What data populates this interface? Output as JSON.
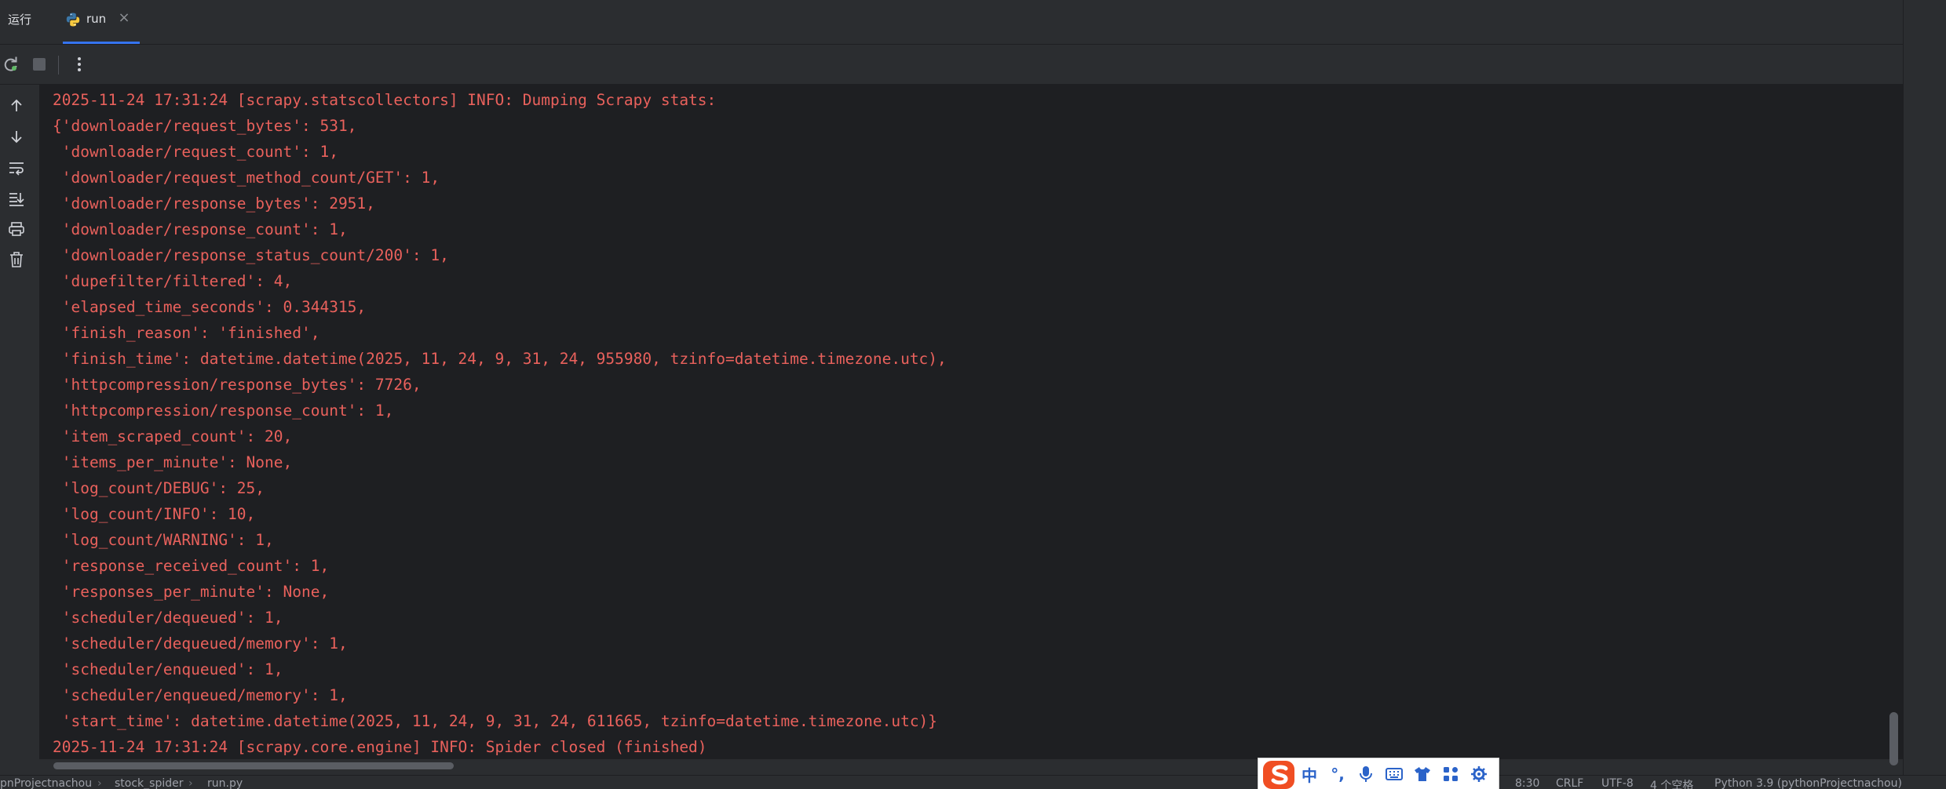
{
  "tool_window": {
    "title": "运行",
    "tab": {
      "label": "run",
      "icon": "python-icon"
    }
  },
  "toolbar": {
    "buttons": [
      "rerun-icon",
      "stop-icon",
      "more-options-icon"
    ]
  },
  "gutter": {
    "buttons": [
      "arrow-up-icon",
      "arrow-down-icon",
      "soft-wrap-icon",
      "scroll-to-end-icon",
      "print-icon",
      "trash-icon"
    ]
  },
  "console": {
    "text_color": "#e9615c",
    "lines": [
      "2025-11-24 17:31:24 [scrapy.statscollectors] INFO: Dumping Scrapy stats:",
      "{'downloader/request_bytes': 531,",
      " 'downloader/request_count': 1,",
      " 'downloader/request_method_count/GET': 1,",
      " 'downloader/response_bytes': 2951,",
      " 'downloader/response_count': 1,",
      " 'downloader/response_status_count/200': 1,",
      " 'dupefilter/filtered': 4,",
      " 'elapsed_time_seconds': 0.344315,",
      " 'finish_reason': 'finished',",
      " 'finish_time': datetime.datetime(2025, 11, 24, 9, 31, 24, 955980, tzinfo=datetime.timezone.utc),",
      " 'httpcompression/response_bytes': 7726,",
      " 'httpcompression/response_count': 1,",
      " 'item_scraped_count': 20,",
      " 'items_per_minute': None,",
      " 'log_count/DEBUG': 25,",
      " 'log_count/INFO': 10,",
      " 'log_count/WARNING': 1,",
      " 'response_received_count': 1,",
      " 'responses_per_minute': None,",
      " 'scheduler/dequeued': 1,",
      " 'scheduler/dequeued/memory': 1,",
      " 'scheduler/enqueued': 1,",
      " 'scheduler/enqueued/memory': 1,",
      " 'start_time': datetime.datetime(2025, 11, 24, 9, 31, 24, 611665, tzinfo=datetime.timezone.utc)}",
      "2025-11-24 17:31:24 [scrapy.core.engine] INFO: Spider closed (finished)"
    ]
  },
  "statusbar": {
    "breadcrumb": [
      "pnProjectnachou",
      "stock_spider",
      "run.py"
    ],
    "right": [
      "8:30",
      "CRLF",
      "UTF-8",
      "4 个空格",
      "Python 3.9 (pythonProjectnachou)"
    ]
  },
  "ime_toolbar": {
    "logo": "sogou-logo",
    "mode_label": "中",
    "punct_label": "°,",
    "buttons": [
      "microphone-icon",
      "keyboard-icon",
      "skin-icon",
      "apps-icon",
      "settings-icon"
    ]
  }
}
